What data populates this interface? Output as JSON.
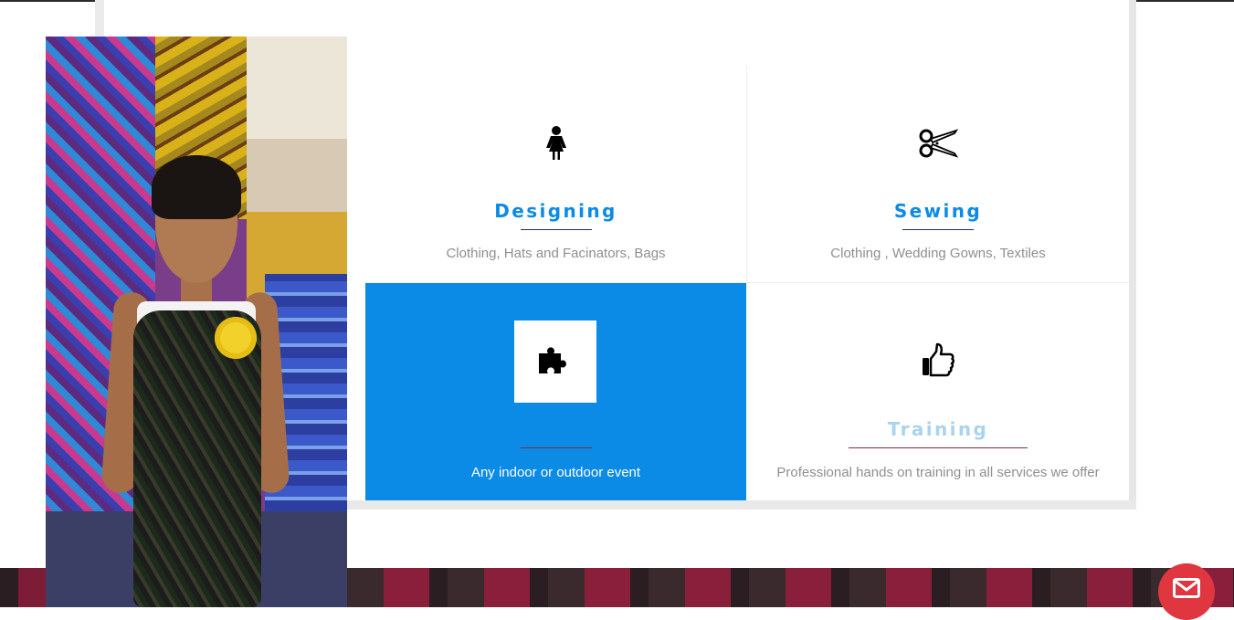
{
  "services": [
    {
      "title": "Designing",
      "description": "Clothing, Hats and Facinators, Bags",
      "icon": "woman-icon"
    },
    {
      "title": "Sewing",
      "description": "Clothing , Wedding Gowns, Textiles",
      "icon": "scissors-icon"
    },
    {
      "title": "",
      "description": "Any indoor or outdoor event",
      "icon": "puzzle-icon",
      "highlighted": true
    },
    {
      "title": "Training",
      "description": "Professional hands on training in all services we offer",
      "icon": "thumbs-up-icon"
    }
  ],
  "colors": {
    "accent": "#0b8be6",
    "title_faded": "#a9d3ef",
    "description": "#8f8f8f",
    "mail_button": "#e03640"
  },
  "floating_button": {
    "icon": "mail-icon"
  }
}
